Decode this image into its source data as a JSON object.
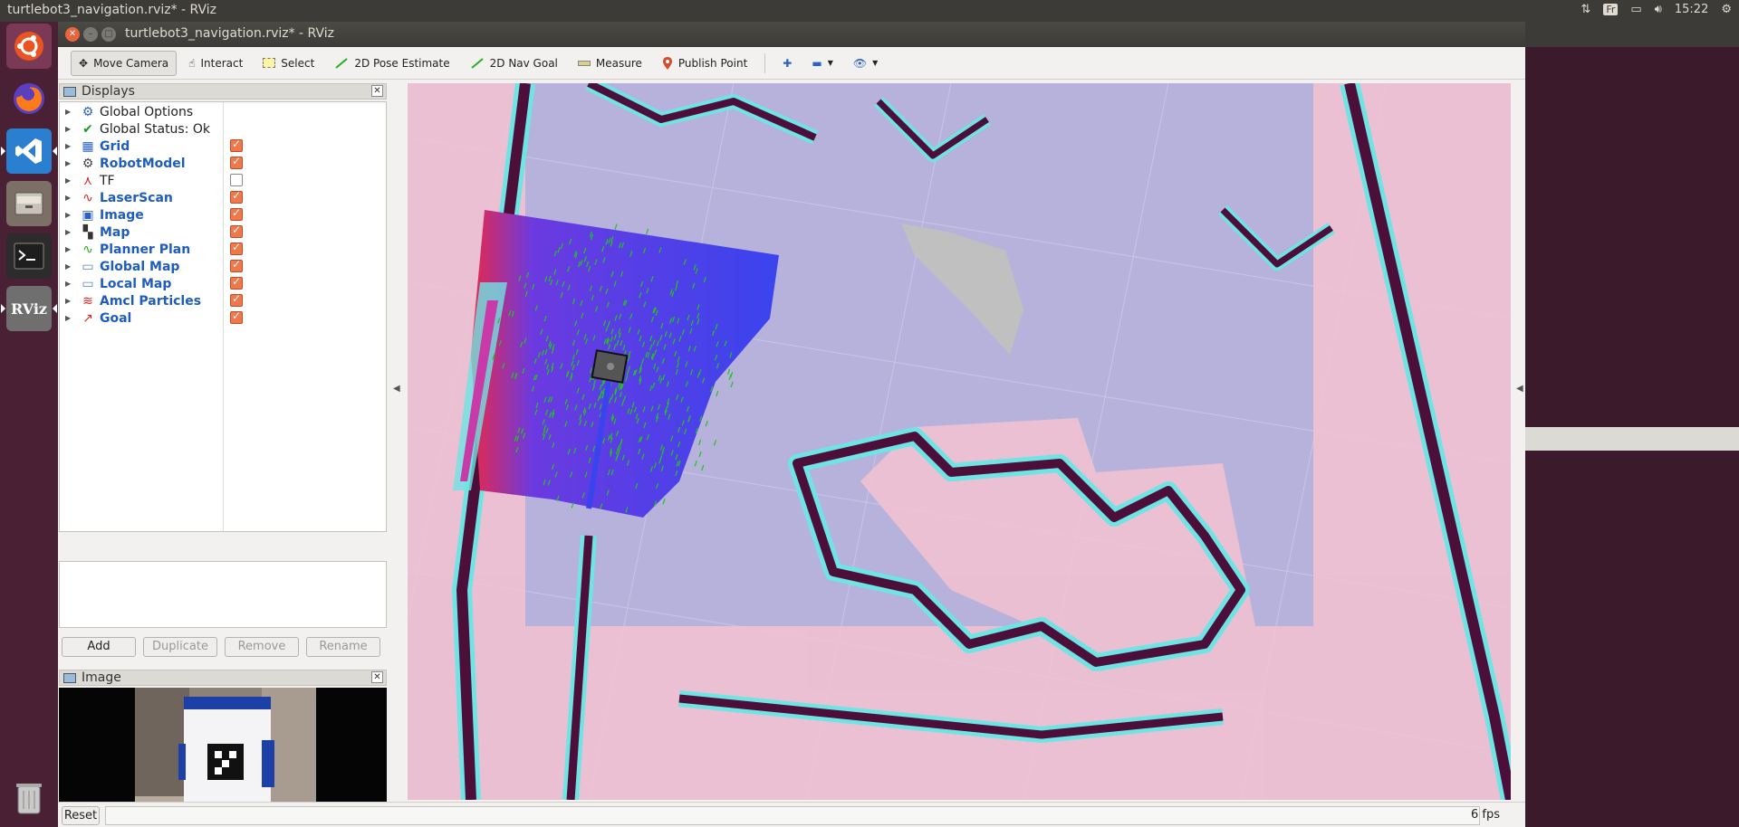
{
  "top_panel": {
    "title": "turtlebot3_navigation.rviz* - RViz",
    "keyboard": "Fr",
    "time": "15:22"
  },
  "launcher": {
    "items": [
      "ubuntu-dash",
      "firefox",
      "vscode",
      "files",
      "terminal",
      "rviz",
      "trash"
    ],
    "rviz_label": "RViz"
  },
  "window": {
    "title": "turtlebot3_navigation.rviz* - RViz"
  },
  "toolbar": {
    "move_camera": "Move Camera",
    "interact": "Interact",
    "select": "Select",
    "pose_estimate": "2D Pose Estimate",
    "nav_goal": "2D Nav Goal",
    "measure": "Measure",
    "publish_point": "Publish Point"
  },
  "displays": {
    "header": "Displays",
    "items": [
      {
        "label": "Global Options",
        "checked": null,
        "bold": false,
        "icon": "gear-icon"
      },
      {
        "label": "Global Status: Ok",
        "checked": null,
        "bold": false,
        "icon": "check-icon"
      },
      {
        "label": "Grid",
        "checked": true,
        "bold": true,
        "icon": "grid-icon"
      },
      {
        "label": "RobotModel",
        "checked": true,
        "bold": true,
        "icon": "robot-icon"
      },
      {
        "label": "TF",
        "checked": false,
        "bold": false,
        "icon": "tf-icon"
      },
      {
        "label": "LaserScan",
        "checked": true,
        "bold": true,
        "icon": "laserscan-icon"
      },
      {
        "label": "Image",
        "checked": true,
        "bold": true,
        "icon": "image-icon"
      },
      {
        "label": "Map",
        "checked": true,
        "bold": true,
        "icon": "map-icon"
      },
      {
        "label": "Planner Plan",
        "checked": true,
        "bold": true,
        "icon": "path-icon"
      },
      {
        "label": "Global Map",
        "checked": true,
        "bold": true,
        "icon": "folder-icon"
      },
      {
        "label": "Local Map",
        "checked": true,
        "bold": true,
        "icon": "folder-icon"
      },
      {
        "label": "Amcl Particles",
        "checked": true,
        "bold": true,
        "icon": "particles-icon"
      },
      {
        "label": "Goal",
        "checked": true,
        "bold": true,
        "icon": "goal-icon"
      }
    ]
  },
  "display_buttons": {
    "add": "Add",
    "duplicate": "Duplicate",
    "remove": "Remove",
    "rename": "Rename"
  },
  "image_panel": {
    "header": "Image"
  },
  "status_bar": {
    "reset": "Reset",
    "fps": "6 fps"
  },
  "colors": {
    "launcher_bg": "#4a2134",
    "map_free": "#b7b2dc",
    "costmap_inflation": "#f4b6c8",
    "obstacle": "#4b0f3a",
    "obstacle_edge": "#6fe4e4",
    "local_costmap": "#3b44e8",
    "particles": "#22c322"
  }
}
